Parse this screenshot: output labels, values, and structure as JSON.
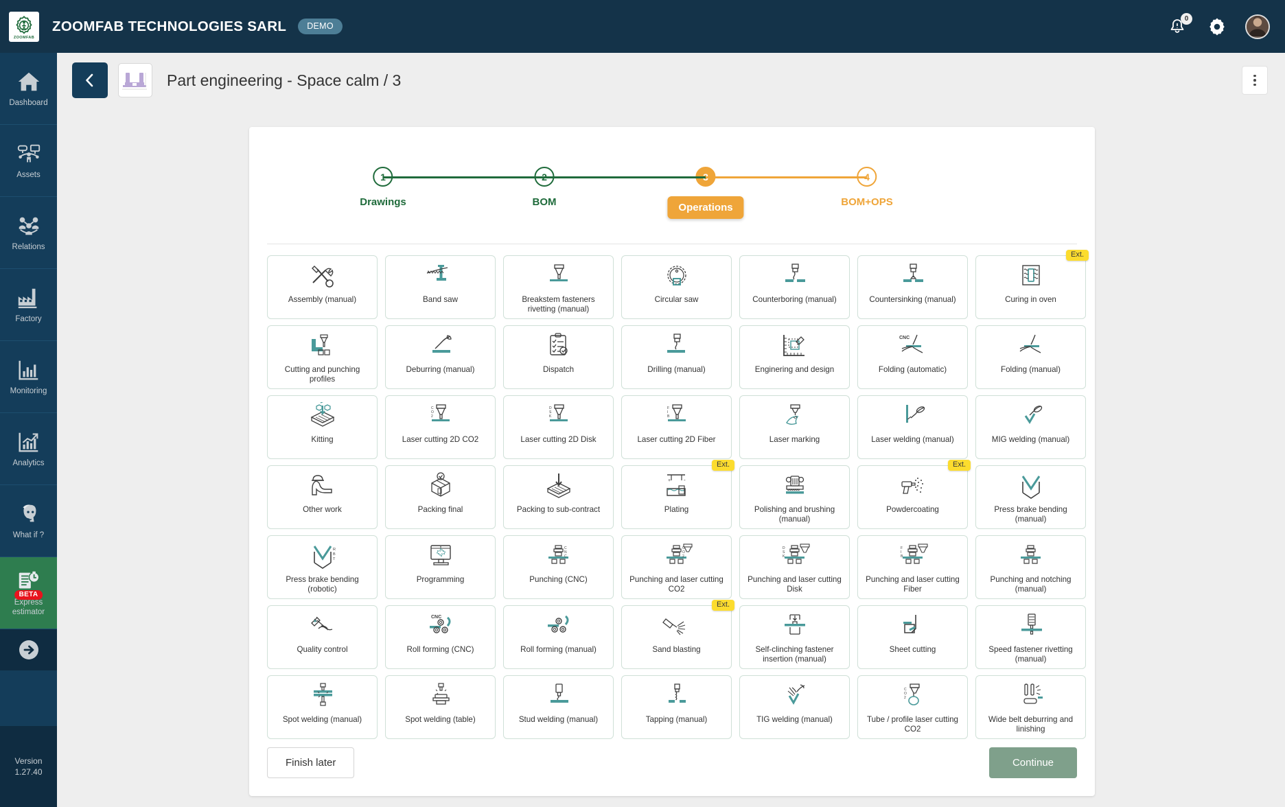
{
  "topbar": {
    "company": "ZOOMFAB TECHNOLOGIES SARL",
    "demo_chip": "DEMO",
    "logo_text": "ZOOMFAB",
    "notification_count": "0",
    "icons": {
      "bell": "bell-icon",
      "gear": "gear-icon",
      "avatar": "avatar"
    }
  },
  "sidebar": {
    "items": [
      {
        "label": "Dashboard",
        "icon": "home-icon",
        "active": false
      },
      {
        "label": "Assets",
        "icon": "assets-icon",
        "active": false
      },
      {
        "label": "Relations",
        "icon": "relations-icon",
        "active": false
      },
      {
        "label": "Factory",
        "icon": "factory-icon",
        "active": false
      },
      {
        "label": "Monitoring",
        "icon": "bar-chart-icon",
        "active": false
      },
      {
        "label": "Analytics",
        "icon": "trend-chart-icon",
        "active": false
      },
      {
        "label": "What if ?",
        "icon": "thinking-person-icon",
        "active": false
      },
      {
        "label": "Express estimator",
        "icon": "estimator-icon",
        "active": true,
        "badge": "BETA"
      }
    ],
    "collapse_icon": "arrow-right-circle-icon",
    "version_label": "Version",
    "version_value": "1.27.40"
  },
  "header": {
    "back_icon": "chevron-left-icon",
    "thumbnail": "part-thumbnail",
    "title": "Part engineering - Space calm / 3",
    "menu_icon": "kebab-menu-icon"
  },
  "stepper": {
    "steps": [
      {
        "number": "1",
        "label": "Drawings",
        "state": "done"
      },
      {
        "number": "2",
        "label": "BOM",
        "state": "done"
      },
      {
        "number": "3",
        "label": "Operations",
        "state": "current"
      },
      {
        "number": "4",
        "label": "BOM+OPS",
        "state": "future"
      }
    ],
    "colors": {
      "done": "#1f6b3b",
      "current": "#efa539",
      "future": "#efa539"
    }
  },
  "operations": [
    {
      "label": "Assembly (manual)",
      "icon": "assembly-icon",
      "ext": false
    },
    {
      "label": "Band saw",
      "icon": "band-saw-icon",
      "ext": false
    },
    {
      "label": "Breakstem fasteners rivetting (manual)",
      "icon": "rivetting-icon",
      "ext": false
    },
    {
      "label": "Circular saw",
      "icon": "circular-saw-icon",
      "ext": false
    },
    {
      "label": "Counterboring (manual)",
      "icon": "counterboring-icon",
      "ext": false
    },
    {
      "label": "Countersinking (manual)",
      "icon": "countersinking-icon",
      "ext": false
    },
    {
      "label": "Curing in oven",
      "icon": "curing-oven-icon",
      "ext": true
    },
    {
      "label": "Cutting and punching profiles",
      "icon": "cutting-punching-profiles-icon",
      "ext": false
    },
    {
      "label": "Deburring (manual)",
      "icon": "deburring-icon",
      "ext": false
    },
    {
      "label": "Dispatch",
      "icon": "dispatch-icon",
      "ext": false
    },
    {
      "label": "Drilling (manual)",
      "icon": "drilling-icon",
      "ext": false
    },
    {
      "label": "Enginering and design",
      "icon": "engineering-design-icon",
      "ext": false
    },
    {
      "label": "Folding (automatic)",
      "icon": "folding-automatic-icon",
      "ext": false
    },
    {
      "label": "Folding (manual)",
      "icon": "folding-manual-icon",
      "ext": false
    },
    {
      "label": "Kitting",
      "icon": "kitting-icon",
      "ext": false
    },
    {
      "label": "Laser cutting 2D CO2",
      "icon": "laser-cutting-co2-icon",
      "ext": false
    },
    {
      "label": "Laser cutting 2D Disk",
      "icon": "laser-cutting-disk-icon",
      "ext": false
    },
    {
      "label": "Laser cutting 2D Fiber",
      "icon": "laser-cutting-fiber-icon",
      "ext": false
    },
    {
      "label": "Laser marking",
      "icon": "laser-marking-icon",
      "ext": false
    },
    {
      "label": "Laser welding (manual)",
      "icon": "laser-welding-icon",
      "ext": false
    },
    {
      "label": "MIG welding (manual)",
      "icon": "mig-welding-icon",
      "ext": false
    },
    {
      "label": "Other work",
      "icon": "other-work-icon",
      "ext": false
    },
    {
      "label": "Packing final",
      "icon": "packing-final-icon",
      "ext": false
    },
    {
      "label": "Packing to sub-contract",
      "icon": "packing-subcontract-icon",
      "ext": false
    },
    {
      "label": "Plating",
      "icon": "plating-icon",
      "ext": true
    },
    {
      "label": "Polishing and brushing (manual)",
      "icon": "polishing-brushing-icon",
      "ext": false
    },
    {
      "label": "Powdercoating",
      "icon": "powdercoating-icon",
      "ext": true
    },
    {
      "label": "Press brake bending (manual)",
      "icon": "press-brake-manual-icon",
      "ext": false
    },
    {
      "label": "Press brake bending (robotic)",
      "icon": "press-brake-robotic-icon",
      "ext": false
    },
    {
      "label": "Programming",
      "icon": "programming-icon",
      "ext": false
    },
    {
      "label": "Punching (CNC)",
      "icon": "punching-cnc-icon",
      "ext": false
    },
    {
      "label": "Punching and laser cutting CO2",
      "icon": "punching-laser-co2-icon",
      "ext": false
    },
    {
      "label": "Punching and laser cutting Disk",
      "icon": "punching-laser-disk-icon",
      "ext": false
    },
    {
      "label": "Punching and laser cutting Fiber",
      "icon": "punching-laser-fiber-icon",
      "ext": false
    },
    {
      "label": "Punching and notching (manual)",
      "icon": "punching-notching-icon",
      "ext": false
    },
    {
      "label": "Quality control",
      "icon": "quality-control-icon",
      "ext": false
    },
    {
      "label": "Roll forming (CNC)",
      "icon": "roll-forming-cnc-icon",
      "ext": false
    },
    {
      "label": "Roll forming (manual)",
      "icon": "roll-forming-manual-icon",
      "ext": false
    },
    {
      "label": "Sand blasting",
      "icon": "sand-blasting-icon",
      "ext": true
    },
    {
      "label": "Self-clinching fastener insertion (manual)",
      "icon": "self-clinching-icon",
      "ext": false
    },
    {
      "label": "Sheet cutting",
      "icon": "sheet-cutting-icon",
      "ext": false
    },
    {
      "label": "Speed fastener rivetting (manual)",
      "icon": "speed-fastener-icon",
      "ext": false
    },
    {
      "label": "Spot welding (manual)",
      "icon": "spot-welding-manual-icon",
      "ext": false
    },
    {
      "label": "Spot welding (table)",
      "icon": "spot-welding-table-icon",
      "ext": false
    },
    {
      "label": "Stud welding (manual)",
      "icon": "stud-welding-icon",
      "ext": false
    },
    {
      "label": "Tapping (manual)",
      "icon": "tapping-icon",
      "ext": false
    },
    {
      "label": "TIG welding (manual)",
      "icon": "tig-welding-icon",
      "ext": false
    },
    {
      "label": "Tube / profile laser cutting CO2",
      "icon": "tube-laser-cutting-icon",
      "ext": false
    },
    {
      "label": "Wide belt deburring and linishing",
      "icon": "wide-belt-deburring-icon",
      "ext": false
    }
  ],
  "ext_tag_label": "Ext.",
  "footer": {
    "finish_later": "Finish later",
    "continue": "Continue"
  },
  "colors": {
    "navy": "#143d5a",
    "topbar_navy": "#143349",
    "green": "#1f6b3b",
    "orange": "#efa539",
    "teal": "#4a9a9a",
    "continue_green": "#7fa08b",
    "ext_yellow": "#fcdc2e",
    "active_green": "#2e7d4f",
    "beta_red": "#e8131d"
  }
}
